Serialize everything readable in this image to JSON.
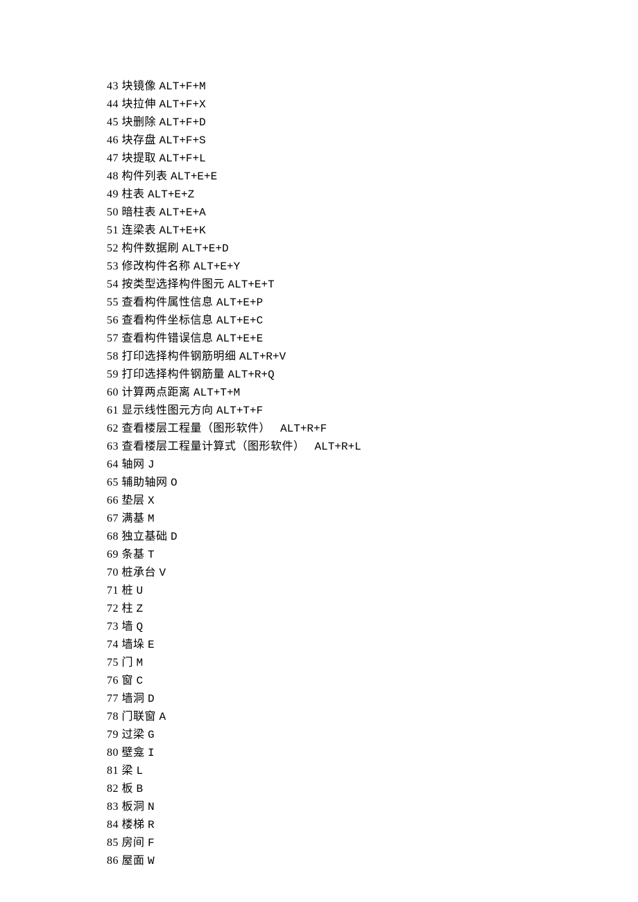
{
  "lines": [
    {
      "num": "43",
      "desc": "块镜像",
      "shortcut": "ALT+F+M"
    },
    {
      "num": "44",
      "desc": "块拉伸",
      "shortcut": "ALT+F+X"
    },
    {
      "num": "45",
      "desc": "块删除",
      "shortcut": "ALT+F+D"
    },
    {
      "num": "46",
      "desc": "块存盘",
      "shortcut": "ALT+F+S"
    },
    {
      "num": "47",
      "desc": "块提取",
      "shortcut": "ALT+F+L"
    },
    {
      "num": "48",
      "desc": "构件列表",
      "shortcut": "ALT+E+E"
    },
    {
      "num": "49",
      "desc": "柱表",
      "shortcut": "ALT+E+Z"
    },
    {
      "num": "50",
      "desc": "暗柱表",
      "shortcut": "ALT+E+A"
    },
    {
      "num": "51",
      "desc": "连梁表",
      "shortcut": "ALT+E+K"
    },
    {
      "num": "52",
      "desc": "构件数据刷",
      "shortcut": "ALT+E+D"
    },
    {
      "num": "53",
      "desc": "修改构件名称",
      "shortcut": "ALT+E+Y"
    },
    {
      "num": "54",
      "desc": "按类型选择构件图元",
      "shortcut": "ALT+E+T"
    },
    {
      "num": "55",
      "desc": "查看构件属性信息",
      "shortcut": "ALT+E+P"
    },
    {
      "num": "56",
      "desc": "查看构件坐标信息",
      "shortcut": "ALT+E+C"
    },
    {
      "num": "57",
      "desc": "查看构件错误信息",
      "shortcut": "ALT+E+E"
    },
    {
      "num": "58",
      "desc": "打印选择构件钢筋明细",
      "shortcut": "ALT+R+V"
    },
    {
      "num": "59",
      "desc": "打印选择构件钢筋量",
      "shortcut": "ALT+R+Q"
    },
    {
      "num": "60",
      "desc": "计算两点距离",
      "shortcut": "ALT+T+M"
    },
    {
      "num": "61",
      "desc": "显示线性图元方向",
      "shortcut": "ALT+T+F"
    },
    {
      "num": "62",
      "desc": "查看楼层工程量（图形软件）",
      "shortcut": " ALT+R+F"
    },
    {
      "num": "63",
      "desc": "查看楼层工程量计算式（图形软件）",
      "shortcut": " ALT+R+L"
    },
    {
      "num": "64",
      "desc": "轴网",
      "shortcut": "J"
    },
    {
      "num": "65",
      "desc": "辅助轴网",
      "shortcut": "O"
    },
    {
      "num": "66",
      "desc": "垫层",
      "shortcut": "X"
    },
    {
      "num": "67",
      "desc": "满基",
      "shortcut": "M"
    },
    {
      "num": "68",
      "desc": "独立基础",
      "shortcut": "D"
    },
    {
      "num": "69",
      "desc": "条基",
      "shortcut": "T"
    },
    {
      "num": "70",
      "desc": "桩承台",
      "shortcut": "V"
    },
    {
      "num": "71",
      "desc": "桩",
      "shortcut": "U"
    },
    {
      "num": "72",
      "desc": "柱",
      "shortcut": "Z"
    },
    {
      "num": "73",
      "desc": "墙",
      "shortcut": "Q"
    },
    {
      "num": "74",
      "desc": "墙垛",
      "shortcut": "E"
    },
    {
      "num": "75",
      "desc": "门",
      "shortcut": "M"
    },
    {
      "num": "76",
      "desc": "窗",
      "shortcut": "C"
    },
    {
      "num": "77",
      "desc": "墙洞",
      "shortcut": "D"
    },
    {
      "num": "78",
      "desc": "门联窗",
      "shortcut": "A"
    },
    {
      "num": "79",
      "desc": "过梁",
      "shortcut": "G"
    },
    {
      "num": "80",
      "desc": "壁龛",
      "shortcut": "I"
    },
    {
      "num": "81",
      "desc": "梁",
      "shortcut": "L"
    },
    {
      "num": "82",
      "desc": "板",
      "shortcut": "B"
    },
    {
      "num": "83",
      "desc": "板洞",
      "shortcut": "N"
    },
    {
      "num": "84",
      "desc": "楼梯",
      "shortcut": "R"
    },
    {
      "num": "85",
      "desc": "房间",
      "shortcut": "F"
    },
    {
      "num": "86",
      "desc": "屋面",
      "shortcut": "W"
    }
  ]
}
